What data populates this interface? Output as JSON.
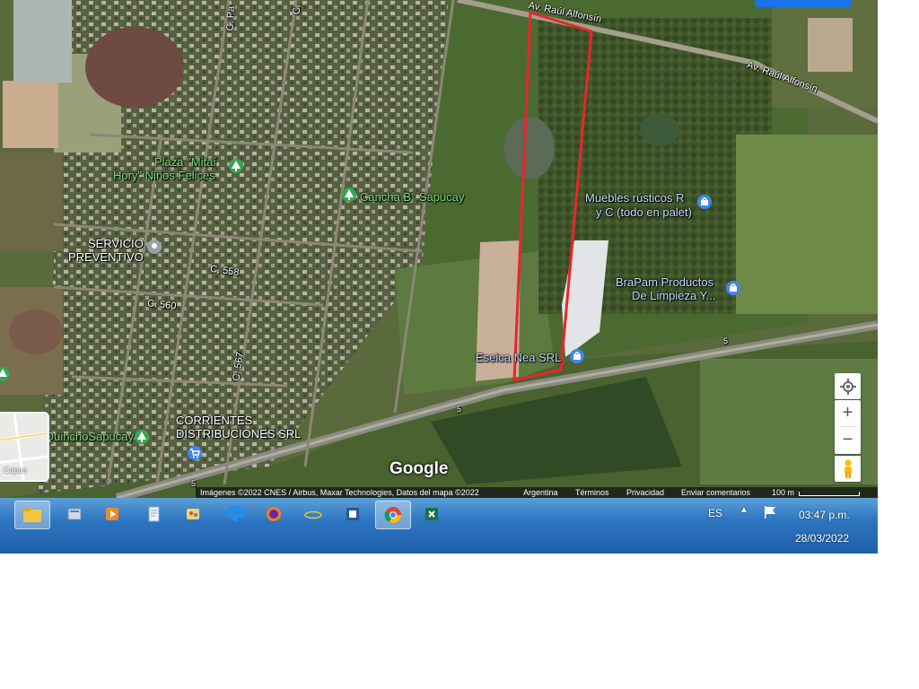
{
  "map": {
    "roads": {
      "av1": "Av. Raúl Alfonsín",
      "av2": "Av. Raúl Alfonsín",
      "c_pa": "C. Pa",
      "c_top": "C.",
      "c558": "C. 558",
      "c560": "C. 560",
      "c567": "C. 567",
      "r5a": "5",
      "r5b": "5",
      "r5c": "5"
    },
    "places": {
      "plaza1": "Plaza \"Mitaí",
      "plaza2": "Hory\" Niños Felices",
      "cancha": "Cancha B° Sapucay",
      "servicio1": "SERVICIO",
      "servicio2": "PREVENTIVO",
      "muebles1": "Muebles rústicos R",
      "muebles2": "y C (todo en palet)",
      "brapam1": "BraPam Productos",
      "brapam2": "De Limpieza Y...",
      "eseica": "Eseica Nea SRL",
      "corrientes1": "CORRIENTES",
      "corrientes2": "DISTRIBUCIONES SRL",
      "quincho": "QuinchoSapucay"
    },
    "layers_label": "Capas",
    "logo": "Google",
    "attribution": {
      "imagery": "Imágenes ©2022 CNES / Airbus, Maxar Technologies, Datos del mapa ©2022",
      "country": "Argentina",
      "terms": "Términos",
      "privacy": "Privacidad",
      "feedback": "Enviar comentarios",
      "scale": "100 m"
    },
    "colors": {
      "boundary": "#e8262c",
      "blue_pin": "#4285f4",
      "green_pin": "#34a853",
      "grey_pin": "#9aa0a6"
    }
  },
  "taskbar": {
    "language": "ES",
    "time": "03:47 p.m.",
    "date": "28/03/2022",
    "apps": [
      "folder-icon",
      "explorer-icon",
      "media-player-icon",
      "notepad-icon",
      "paint-icon",
      "edge-icon",
      "firefox-icon",
      "ie-icon",
      "word-icon",
      "chrome-icon",
      "excel-icon"
    ]
  }
}
